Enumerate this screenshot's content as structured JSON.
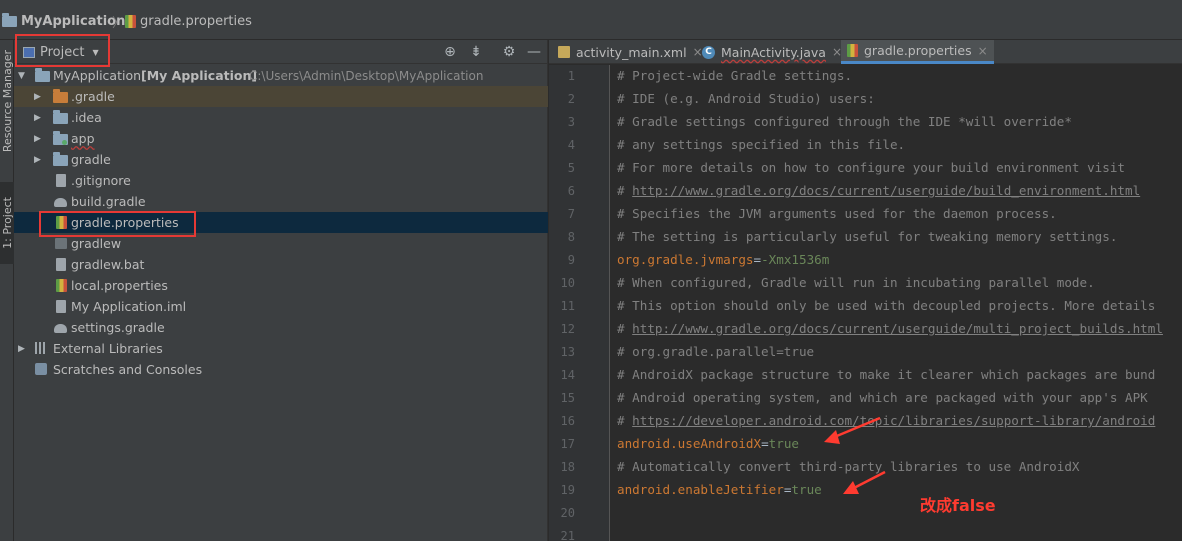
{
  "breadcrumb": {
    "project": "MyApplication",
    "separator": "〉",
    "file": "gradle.properties"
  },
  "left_strip": {
    "resource_manager": "Resource Manager",
    "project_tab": "1: Project"
  },
  "project_panel": {
    "view_mode": "Project",
    "header_icons": [
      "locate-icon",
      "collapse-all-icon",
      "gear-icon",
      "minimize-icon"
    ],
    "root": {
      "name": "MyApplication",
      "module": "[My Application]",
      "path": "C:\\Users\\Admin\\Desktop\\MyApplication"
    },
    "items": [
      {
        "label": ".gradle"
      },
      {
        "label": ".idea"
      },
      {
        "label": "app"
      },
      {
        "label": "gradle"
      },
      {
        "label": ".gitignore"
      },
      {
        "label": "build.gradle"
      },
      {
        "label": "gradle.properties"
      },
      {
        "label": "gradlew"
      },
      {
        "label": "gradlew.bat"
      },
      {
        "label": "local.properties"
      },
      {
        "label": "My Application.iml"
      },
      {
        "label": "settings.gradle"
      }
    ],
    "external_libraries": "External Libraries",
    "scratches": "Scratches and Consoles"
  },
  "editor": {
    "tabs": [
      {
        "label": "activity_main.xml"
      },
      {
        "label": "MainActivity.java"
      },
      {
        "label": "gradle.properties"
      }
    ],
    "close_glyph": "×",
    "line_numbers": [
      "1",
      "2",
      "3",
      "4",
      "5",
      "6",
      "7",
      "8",
      "9",
      "10",
      "11",
      "12",
      "13",
      "14",
      "15",
      "16",
      "17",
      "18",
      "19",
      "20",
      "21"
    ],
    "lines": {
      "l1": "# Project-wide Gradle settings.",
      "l2": "# IDE (e.g. Android Studio) users:",
      "l3": "# Gradle settings configured through the IDE *will override*",
      "l4": "# any settings specified in this file.",
      "l5": "# For more details on how to configure your build environment visit",
      "l6_prefix": "# ",
      "l6_link": "http://www.gradle.org/docs/current/userguide/build_environment.html",
      "l7": "# Specifies the JVM arguments used for the daemon process.",
      "l8": "# The setting is particularly useful for tweaking memory settings.",
      "l9_key": "org.gradle.jvmargs",
      "l9_value": "-Xmx1536m",
      "l10": "# When configured, Gradle will run in incubating parallel mode.",
      "l11": "# This option should only be used with decoupled projects. More details",
      "l12_prefix": "# ",
      "l12_link": "http://www.gradle.org/docs/current/userguide/multi_project_builds.html",
      "l13": "# org.gradle.parallel=true",
      "l14": "# AndroidX package structure to make it clearer which packages are bund",
      "l15": "# Android operating system, and which are packaged with your app's APK",
      "l16_prefix": "# ",
      "l16_link": "https://developer.android.com/topic/libraries/support-library/android",
      "l17_key": "android.useAndroidX",
      "l17_value": "true",
      "l18": "# Automatically convert third-party libraries to use AndroidX",
      "l19_key": "android.enableJetifier",
      "l19_value": "true"
    }
  },
  "annotation": {
    "note": "改成false",
    "color": "#ff3b30"
  },
  "colors": {
    "accent": "#4a88c7",
    "keyword": "#cc7832",
    "value": "#6a8759",
    "comment": "#808080",
    "selection": "#0d293e"
  }
}
